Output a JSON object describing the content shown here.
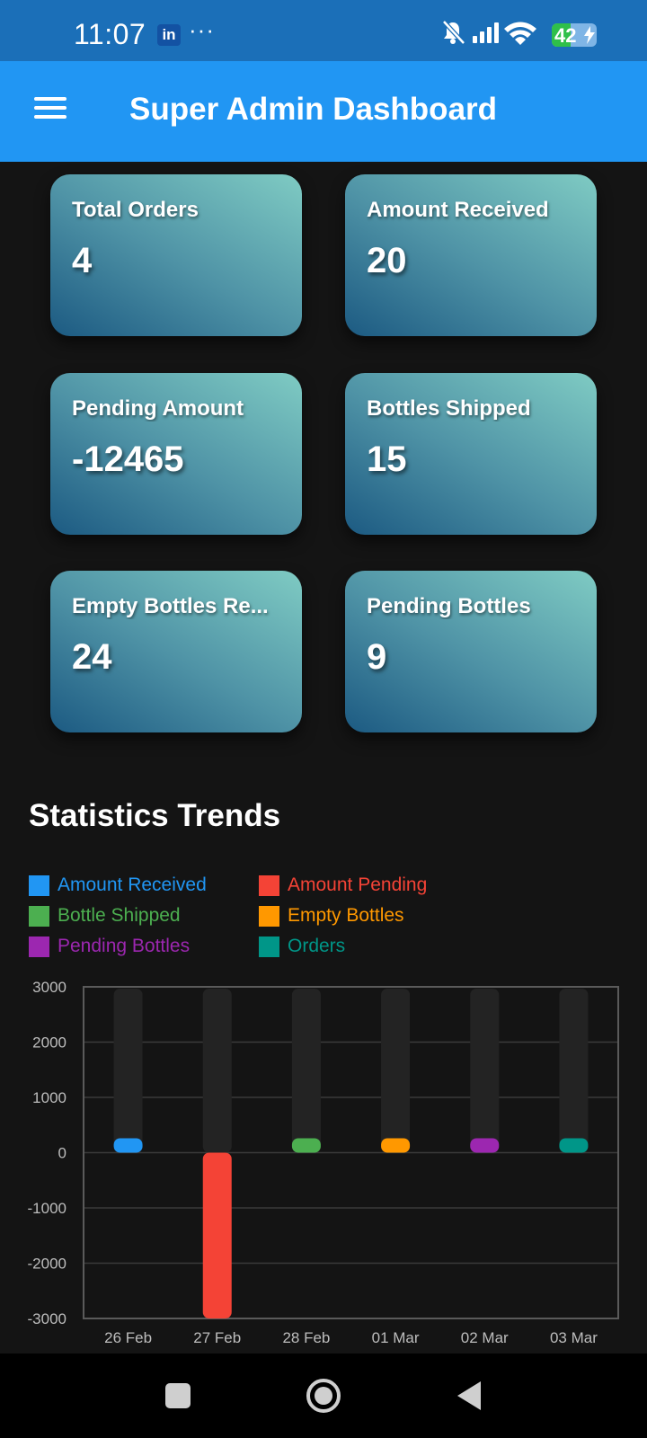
{
  "status_bar": {
    "time": "11:07",
    "notification_badge": "in",
    "overflow": "···",
    "battery_percent": "42",
    "battery_level": 0.42
  },
  "app_bar": {
    "title": "Super Admin Dashboard",
    "menu_icon": "hamburger-menu-icon"
  },
  "cards": [
    {
      "label": "Total Orders",
      "value": "4"
    },
    {
      "label": "Amount Received",
      "value": "20"
    },
    {
      "label": "Pending Amount",
      "value": "-12465"
    },
    {
      "label": "Bottles Shipped",
      "value": "15"
    },
    {
      "label": "Empty Bottles Re...",
      "value": "24"
    },
    {
      "label": "Pending Bottles",
      "value": "9"
    }
  ],
  "stats": {
    "title": "Statistics Trends",
    "legend": [
      {
        "name": "Amount Received",
        "color": "#2196f3"
      },
      {
        "name": "Amount Pending",
        "color": "#f44336"
      },
      {
        "name": "Bottle Shipped",
        "color": "#4caf50"
      },
      {
        "name": "Empty Bottles",
        "color": "#ff9800"
      },
      {
        "name": "Pending Bottles",
        "color": "#9c27b0"
      },
      {
        "name": "Orders",
        "color": "#009688"
      }
    ]
  },
  "chart_data": {
    "type": "bar",
    "categories": [
      "26 Feb",
      "27 Feb",
      "28 Feb",
      "01 Mar",
      "02 Mar",
      "03 Mar"
    ],
    "series": [
      {
        "name": "Amount Received",
        "values": [
          20,
          0,
          0,
          0,
          0,
          0
        ],
        "color": "#2196f3"
      },
      {
        "name": "Amount Pending",
        "values": [
          0,
          -3000,
          0,
          0,
          0,
          0
        ],
        "color": "#f44336"
      },
      {
        "name": "Bottle Shipped",
        "values": [
          0,
          0,
          15,
          0,
          0,
          0
        ],
        "color": "#4caf50"
      },
      {
        "name": "Empty Bottles",
        "values": [
          0,
          0,
          0,
          24,
          0,
          0
        ],
        "color": "#ff9800"
      },
      {
        "name": "Pending Bottles",
        "values": [
          0,
          0,
          0,
          0,
          9,
          0
        ],
        "color": "#9c27b0"
      },
      {
        "name": "Orders",
        "values": [
          0,
          0,
          0,
          0,
          0,
          4
        ],
        "color": "#009688"
      }
    ],
    "y_ticks": [
      "3000",
      "2000",
      "1000",
      "0",
      "-1000",
      "-2000",
      "-3000"
    ],
    "ylim": [
      -3000,
      3000
    ],
    "background_bars": true,
    "grid": true,
    "legend_position": "top"
  },
  "nav_bar": {
    "buttons": [
      "recents-icon",
      "home-icon",
      "back-icon"
    ]
  }
}
